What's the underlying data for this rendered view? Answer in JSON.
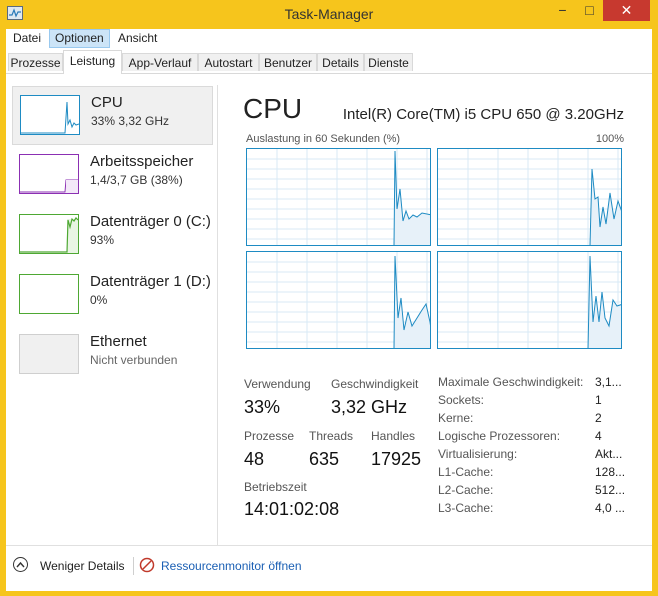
{
  "window": {
    "title": "Task-Manager",
    "minimize_glyph": "−",
    "maximize_glyph": "□",
    "close_glyph": "✕"
  },
  "menu": [
    "Datei",
    "Optionen",
    "Ansicht"
  ],
  "tabs": [
    "Prozesse",
    "Leistung",
    "App-Verlauf",
    "Autostart",
    "Benutzer",
    "Details",
    "Dienste"
  ],
  "sidebar": [
    {
      "title": "CPU",
      "sub": "33% 3,32 GHz",
      "color": "#1e8bc3"
    },
    {
      "title": "Arbeitsspeicher",
      "sub": "1,4/3,7 GB (38%)",
      "color": "#8b2fb3"
    },
    {
      "title": "Datenträger 0 (C:)",
      "sub": "93%",
      "color": "#4ea833"
    },
    {
      "title": "Datenträger 1 (D:)",
      "sub": "0%",
      "color": "#4ea833"
    },
    {
      "title": "Ethernet",
      "sub": "Nicht verbunden",
      "color": "#bcbcbc"
    }
  ],
  "cpu": {
    "title": "CPU",
    "model": "Intel(R) Core(TM) i5 CPU 650 @ 3.20GHz",
    "chart_label": "Auslastung in 60 Sekunden (%)",
    "chart_max": "100%",
    "stats": {
      "usage_label": "Verwendung",
      "usage_value": "33%",
      "speed_label": "Geschwindigkeit",
      "speed_value": "3,32 GHz",
      "processes_label": "Prozesse",
      "processes_value": "48",
      "threads_label": "Threads",
      "threads_value": "635",
      "handles_label": "Handles",
      "handles_value": "17925",
      "uptime_label": "Betriebszeit",
      "uptime_value": "14:01:02:08"
    },
    "specs": [
      {
        "key": "Maximale Geschwindigkeit:",
        "value": "3,1..."
      },
      {
        "key": "Sockets:",
        "value": "1"
      },
      {
        "key": "Kerne:",
        "value": "2"
      },
      {
        "key": "Logische Prozessoren:",
        "value": "4"
      },
      {
        "key": "Virtualisierung:",
        "value": "Akt..."
      },
      {
        "key": "L1-Cache:",
        "value": "128..."
      },
      {
        "key": "L2-Cache:",
        "value": "512..."
      },
      {
        "key": "L3-Cache:",
        "value": "4,0 ..."
      }
    ]
  },
  "footer": {
    "fewer_details": "Weniger Details",
    "resource_monitor": "Ressourcenmonitor öffnen"
  }
}
